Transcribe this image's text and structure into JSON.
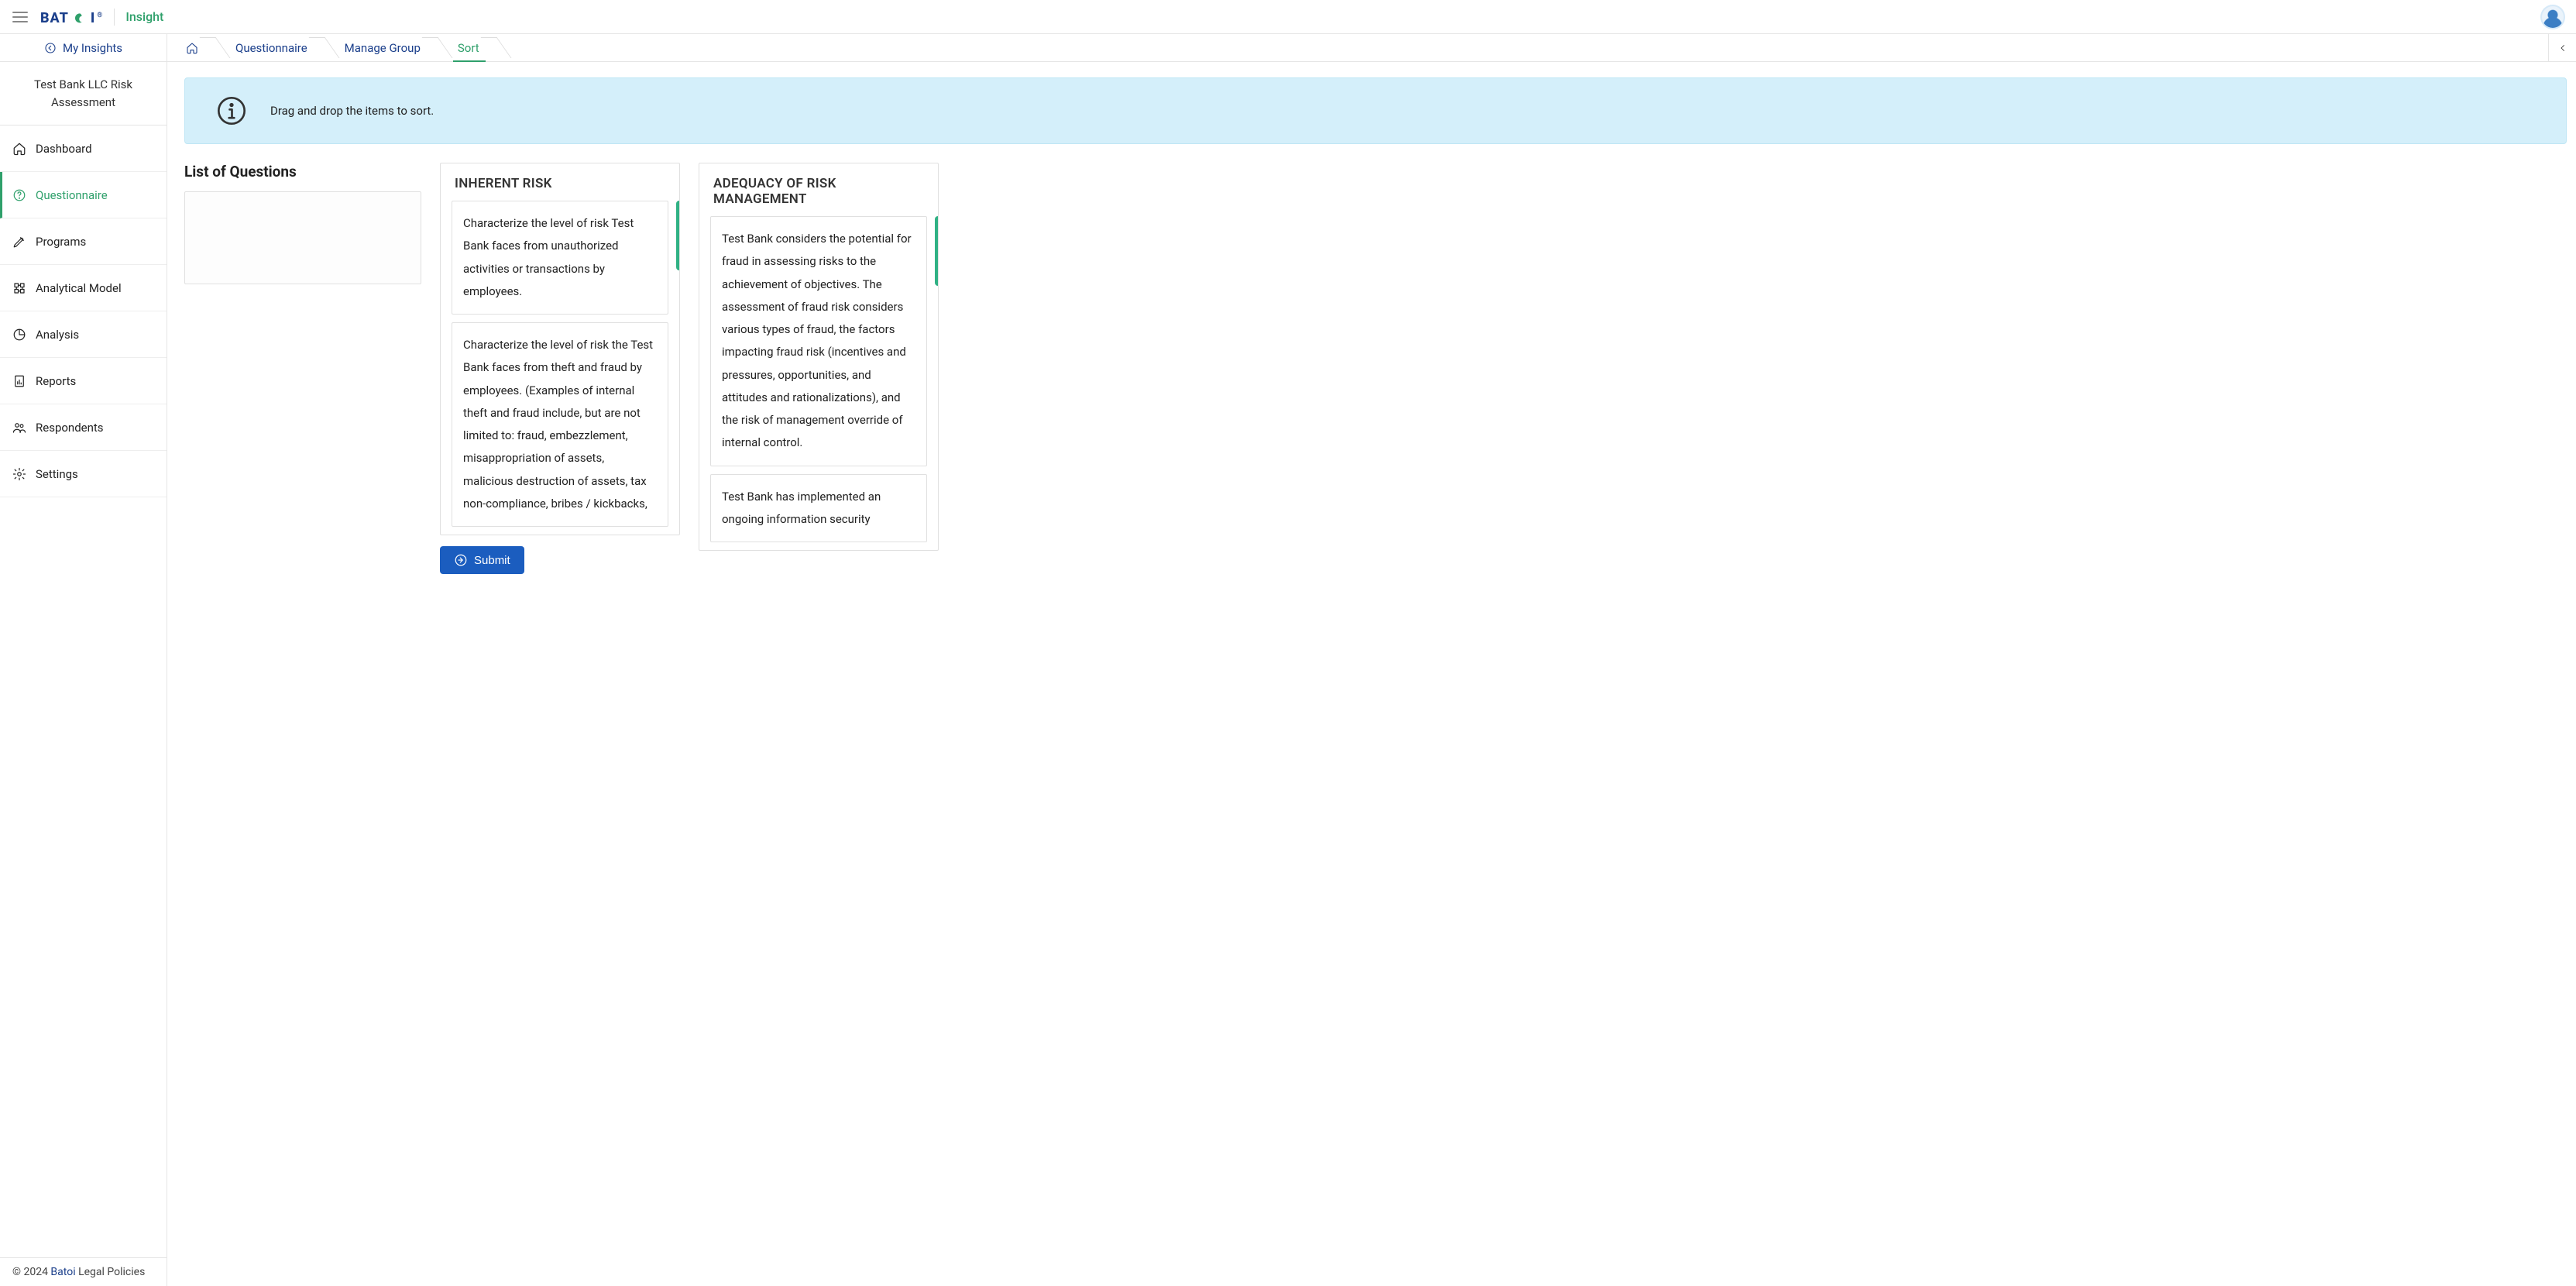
{
  "header": {
    "brand_text": "BAT",
    "brand_leaf": "◉",
    "brand_text2": "I",
    "brand_reg": "®",
    "app_name": "Insight"
  },
  "sidebar": {
    "my_insights_label": "My Insights",
    "project_title": "Test Bank LLC Risk Assessment",
    "nav": [
      {
        "label": "Dashboard"
      },
      {
        "label": "Questionnaire"
      },
      {
        "label": "Programs"
      },
      {
        "label": "Analytical Model"
      },
      {
        "label": "Analysis"
      },
      {
        "label": "Reports"
      },
      {
        "label": "Respondents"
      },
      {
        "label": "Settings"
      }
    ],
    "footer_prefix": "© 2024 ",
    "footer_link": "Batoi",
    "footer_suffix": " Legal Policies"
  },
  "breadcrumbs": {
    "items": [
      {
        "label": "Questionnaire"
      },
      {
        "label": "Manage Group"
      },
      {
        "label": "Sort"
      }
    ]
  },
  "banner": {
    "text": "Drag and drop the items to sort."
  },
  "sort": {
    "list_heading": "List of Questions",
    "groups": [
      {
        "title": "INHERENT RISK",
        "questions": [
          "Characterize the level of risk Test Bank faces from unauthorized activities or transactions by employees.",
          "Characterize the level of risk the Test Bank faces from theft and fraud by employees. (Examples of internal theft and fraud include, but are not limited to: fraud, embezzlement, misappropriation of assets, malicious destruction of assets, tax non-compliance, bribes / kickbacks,"
        ]
      },
      {
        "title": "ADEQUACY OF RISK MANAGEMENT",
        "questions": [
          "Test Bank considers the potential for fraud in assessing risks to the achievement of objectives. The assessment of fraud risk considers various types of fraud, the factors impacting fraud risk (incentives and pressures, opportunities, and attitudes and rationalizations), and the risk of management override of internal control.",
          "Test Bank has implemented an ongoing information security"
        ]
      }
    ],
    "submit_label": "Submit"
  }
}
